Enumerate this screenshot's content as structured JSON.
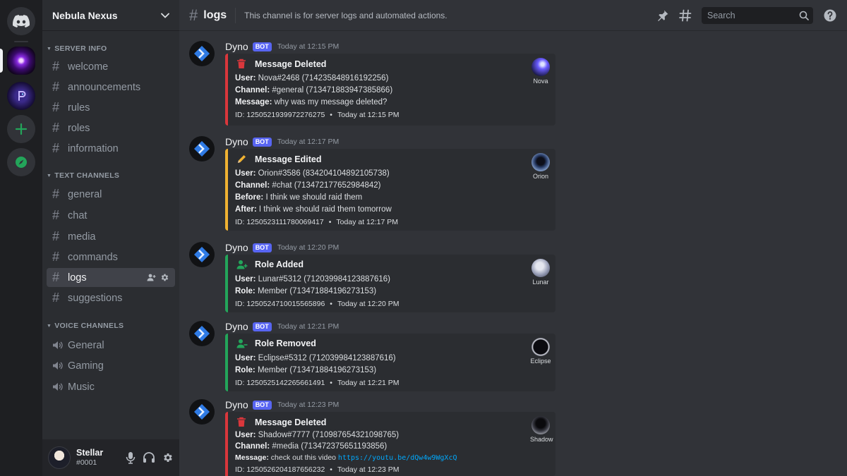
{
  "server": {
    "name": "Nebula Nexus",
    "categories": [
      {
        "name": "SERVER INFO",
        "channels": [
          "welcome",
          "announcements",
          "rules",
          "roles",
          "information"
        ]
      },
      {
        "name": "TEXT CHANNELS",
        "channels": [
          "general",
          "chat",
          "media",
          "commands",
          "logs",
          "suggestions"
        ]
      },
      {
        "name": "VOICE CHANNELS",
        "channels": [
          "General",
          "Gaming",
          "Music"
        ]
      }
    ],
    "active_channel": "logs"
  },
  "user": {
    "name": "Stellar",
    "tag": "#0001"
  },
  "topbar": {
    "channel": "logs",
    "topic": "This channel is for server logs and automated actions.",
    "search_placeholder": "Search"
  },
  "colors": {
    "deleted": "#da373c",
    "edited": "#f0b232",
    "role": "#23a55a",
    "accent": "#5865f2"
  },
  "messages": [
    {
      "author": "Dyno",
      "badge": "BOT",
      "time": "Today at 12:15 PM",
      "title": "Message Deleted",
      "icon": "trash-icon",
      "fields": [
        {
          "label": "User:",
          "value": "Nova#2468 (714235848916192256)"
        },
        {
          "label": "Channel:",
          "value": "#general (713471883947385866)"
        },
        {
          "label": "Message:",
          "value": "why was my message deleted?"
        }
      ],
      "footer_id": "ID: 1250521939972276275",
      "footer_time": "Today at 12:15 PM",
      "thumb": "Nova"
    },
    {
      "author": "Dyno",
      "badge": "BOT",
      "time": "Today at 12:17 PM",
      "title": "Message Edited",
      "icon": "pencil-icon",
      "fields": [
        {
          "label": "User:",
          "value": "Orion#3586 (834204104892105738)"
        },
        {
          "label": "Channel:",
          "value": "#chat (713472177652984842)"
        },
        {
          "label": "Before:",
          "value": "I think we should raid them"
        },
        {
          "label": "After:",
          "value": "I think we should raid them tomorrow"
        }
      ],
      "footer_id": "ID: 1250523111780069417",
      "footer_time": "Today at 12:17 PM",
      "thumb": "Orion"
    },
    {
      "author": "Dyno",
      "badge": "BOT",
      "time": "Today at 12:20 PM",
      "title": "Role Added",
      "icon": "user-plus-icon",
      "fields": [
        {
          "label": "User:",
          "value": "Lunar#5312 (712039984123887616)"
        },
        {
          "label": "Role:",
          "value": "Member (713471884196273153)"
        }
      ],
      "footer_id": "ID: 1250524710015565896",
      "footer_time": "Today at 12:20 PM",
      "thumb": "Lunar"
    },
    {
      "author": "Dyno",
      "badge": "BOT",
      "time": "Today at 12:21 PM",
      "title": "Role Removed",
      "icon": "user-minus-icon",
      "fields": [
        {
          "label": "User:",
          "value": "Eclipse#5312 (712039984123887616)"
        },
        {
          "label": "Role:",
          "value": "Member (713471884196273153)"
        }
      ],
      "footer_id": "ID: 1250525142265661491",
      "footer_time": "Today at 12:21 PM",
      "thumb": "Eclipse"
    },
    {
      "author": "Dyno",
      "badge": "BOT",
      "time": "Today at 12:23 PM",
      "title": "Message Deleted",
      "icon": "trash-icon",
      "fields": [
        {
          "label": "User:",
          "value": "Shadow#7777 (710987654321098765)"
        },
        {
          "label": "Channel:",
          "value": "#media (713472375651193856)"
        },
        {
          "label": "Message:",
          "value": "check out this video ",
          "link": "https://youtu.be/dQw4w9WgXcQ"
        }
      ],
      "footer_id": "ID: 1250526204187656232",
      "footer_time": "Today at 12:23 PM",
      "thumb": "Shadow"
    }
  ]
}
